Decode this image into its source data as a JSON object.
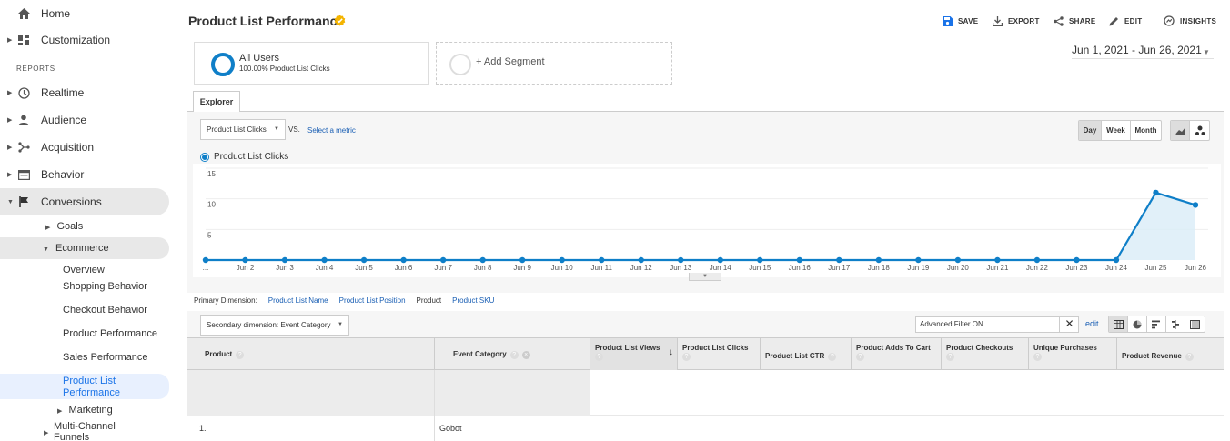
{
  "sidebar": {
    "items": [
      {
        "label": "Home",
        "icon": "home-icon"
      },
      {
        "label": "Customization",
        "icon": "dashboard-grid-icon"
      },
      {
        "label": "Realtime",
        "icon": "clock-icon"
      },
      {
        "label": "Audience",
        "icon": "person-icon"
      },
      {
        "label": "Acquisition",
        "icon": "acquisition-icon"
      },
      {
        "label": "Behavior",
        "icon": "behavior-icon"
      },
      {
        "label": "Conversions",
        "icon": "flag-icon"
      }
    ],
    "section_label": "REPORTS",
    "conversions_children": {
      "goals": "Goals",
      "ecommerce": "Ecommerce",
      "marketing": "Marketing",
      "multichannel": "Multi-Channel Funnels"
    },
    "ecommerce_children": [
      "Overview",
      "Shopping Behavior",
      "Checkout Behavior",
      "Product Performance",
      "Sales Performance",
      "Product List Performance"
    ]
  },
  "header": {
    "title": "Product List Performance",
    "actions": {
      "save": "SAVE",
      "export": "EXPORT",
      "share": "SHARE",
      "edit": "EDIT",
      "insights": "INSIGHTS"
    }
  },
  "segments": {
    "primary": {
      "name": "All Users",
      "detail": "100.00% Product List Clicks"
    },
    "add": "+ Add Segment"
  },
  "date_range": "Jun 1, 2021 - Jun 26, 2021",
  "explorer": {
    "tab": "Explorer",
    "metric": "Product List Clicks",
    "vs": "VS.",
    "select_metric": "Select a metric",
    "granularity": [
      "Day",
      "Week",
      "Month"
    ],
    "granularity_selected": "Day",
    "legend": "Product List Clicks"
  },
  "chart_data": {
    "type": "area",
    "series": [
      {
        "name": "Product List Clicks",
        "values": [
          0,
          0,
          0,
          0,
          0,
          0,
          0,
          0,
          0,
          0,
          0,
          0,
          0,
          0,
          0,
          0,
          0,
          0,
          0,
          0,
          0,
          0,
          0,
          0,
          11,
          9
        ]
      }
    ],
    "x": [
      "...",
      "Jun 2",
      "Jun 3",
      "Jun 4",
      "Jun 5",
      "Jun 6",
      "Jun 7",
      "Jun 8",
      "Jun 9",
      "Jun 10",
      "Jun 11",
      "Jun 12",
      "Jun 13",
      "Jun 14",
      "Jun 15",
      "Jun 16",
      "Jun 17",
      "Jun 18",
      "Jun 19",
      "Jun 20",
      "Jun 21",
      "Jun 22",
      "Jun 23",
      "Jun 24",
      "Jun 25",
      "Jun 26"
    ],
    "yticks": [
      "15",
      "10",
      "5"
    ],
    "ylim": [
      0,
      15
    ],
    "color": "#0f7fc8",
    "grid": true
  },
  "primary_dimension": {
    "label": "Primary Dimension:",
    "options": [
      "Product List Name",
      "Product List Position",
      "Product",
      "Product SKU"
    ],
    "selected": "Product"
  },
  "table_toolbar": {
    "secondary_dimension": "Secondary dimension: Event Category",
    "filter": "Advanced Filter ON",
    "filter_edit": "edit"
  },
  "table": {
    "columns": [
      "Product",
      "Event Category",
      "Product List Views",
      "Product List Clicks",
      "Product List CTR",
      "Product Adds To Cart",
      "Product Checkouts",
      "Unique Purchases",
      "Product Revenue"
    ],
    "rows": [
      {
        "num": "1.",
        "event_category": "Gobot"
      }
    ]
  }
}
